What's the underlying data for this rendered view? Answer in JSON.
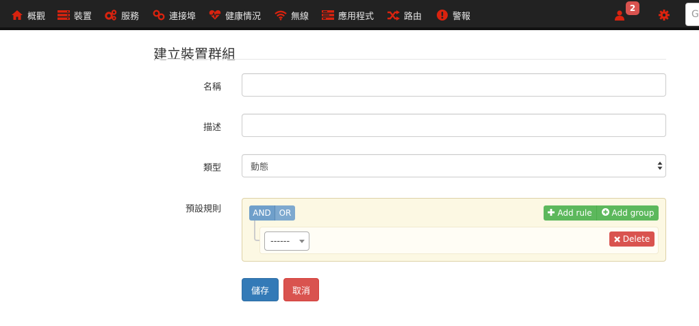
{
  "nav": {
    "items": [
      {
        "label": "概觀",
        "icon": "home-icon"
      },
      {
        "label": "裝置",
        "icon": "server-icon"
      },
      {
        "label": "服務",
        "icon": "cogs-icon"
      },
      {
        "label": "連接埠",
        "icon": "link-icon"
      },
      {
        "label": "健康情況",
        "icon": "heartbeat-icon"
      },
      {
        "label": "無線",
        "icon": "wifi-icon"
      },
      {
        "label": "應用程式",
        "icon": "tasks-icon"
      },
      {
        "label": "路由",
        "icon": "random-icon"
      },
      {
        "label": "警報",
        "icon": "exclamation-circle-icon"
      }
    ],
    "user_badge": "2",
    "search_placeholder": "G",
    "accent_color": "#d9230f"
  },
  "page": {
    "title": "建立裝置群組"
  },
  "form": {
    "name_label": "名稱",
    "name_value": "",
    "description_label": "描述",
    "description_value": "",
    "type_label": "類型",
    "type_value": "動態",
    "rules_label": "預設規則"
  },
  "rules": {
    "and_label": "AND",
    "or_label": "OR",
    "add_rule_label": "Add rule",
    "add_group_label": "Add group",
    "field_value": "------",
    "delete_label": "Delete"
  },
  "actions": {
    "save_label": "儲存",
    "cancel_label": "取消"
  }
}
